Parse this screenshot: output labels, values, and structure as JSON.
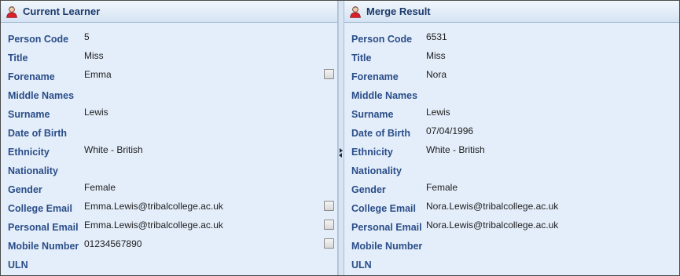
{
  "left": {
    "title": "Current Learner",
    "icon": "user-icon",
    "rows": [
      {
        "label": "Person Code",
        "value": "5",
        "checkbox": false
      },
      {
        "label": "Title",
        "value": "Miss",
        "checkbox": false
      },
      {
        "label": "Forename",
        "value": "Emma",
        "checkbox": true
      },
      {
        "label": "Middle Names",
        "value": "",
        "checkbox": false
      },
      {
        "label": "Surname",
        "value": "Lewis",
        "checkbox": false
      },
      {
        "label": "Date of Birth",
        "value": "",
        "checkbox": false
      },
      {
        "label": "Ethnicity",
        "value": "White - British",
        "checkbox": false
      },
      {
        "label": "Nationality",
        "value": "",
        "checkbox": false
      },
      {
        "label": "Gender",
        "value": "Female",
        "checkbox": false
      },
      {
        "label": "College Email",
        "value": "Emma.Lewis@tribalcollege.ac.uk",
        "checkbox": true
      },
      {
        "label": "Personal Email",
        "value": "Emma.Lewis@tribalcollege.ac.uk",
        "checkbox": true
      },
      {
        "label": "Mobile Number",
        "value": "01234567890",
        "checkbox": true
      },
      {
        "label": "ULN",
        "value": "",
        "checkbox": false
      }
    ]
  },
  "right": {
    "title": "Merge Result",
    "icon": "user-icon",
    "rows": [
      {
        "label": "Person Code",
        "value": "6531"
      },
      {
        "label": "Title",
        "value": "Miss"
      },
      {
        "label": "Forename",
        "value": "Nora"
      },
      {
        "label": "Middle Names",
        "value": ""
      },
      {
        "label": "Surname",
        "value": "Lewis"
      },
      {
        "label": "Date of Birth",
        "value": "07/04/1996"
      },
      {
        "label": "Ethnicity",
        "value": "White - British"
      },
      {
        "label": "Nationality",
        "value": ""
      },
      {
        "label": "Gender",
        "value": "Female"
      },
      {
        "label": "College Email",
        "value": "Nora.Lewis@tribalcollege.ac.uk"
      },
      {
        "label": "Personal Email",
        "value": "Nora.Lewis@tribalcollege.ac.uk"
      },
      {
        "label": "Mobile Number",
        "value": ""
      },
      {
        "label": "ULN",
        "value": ""
      }
    ]
  }
}
